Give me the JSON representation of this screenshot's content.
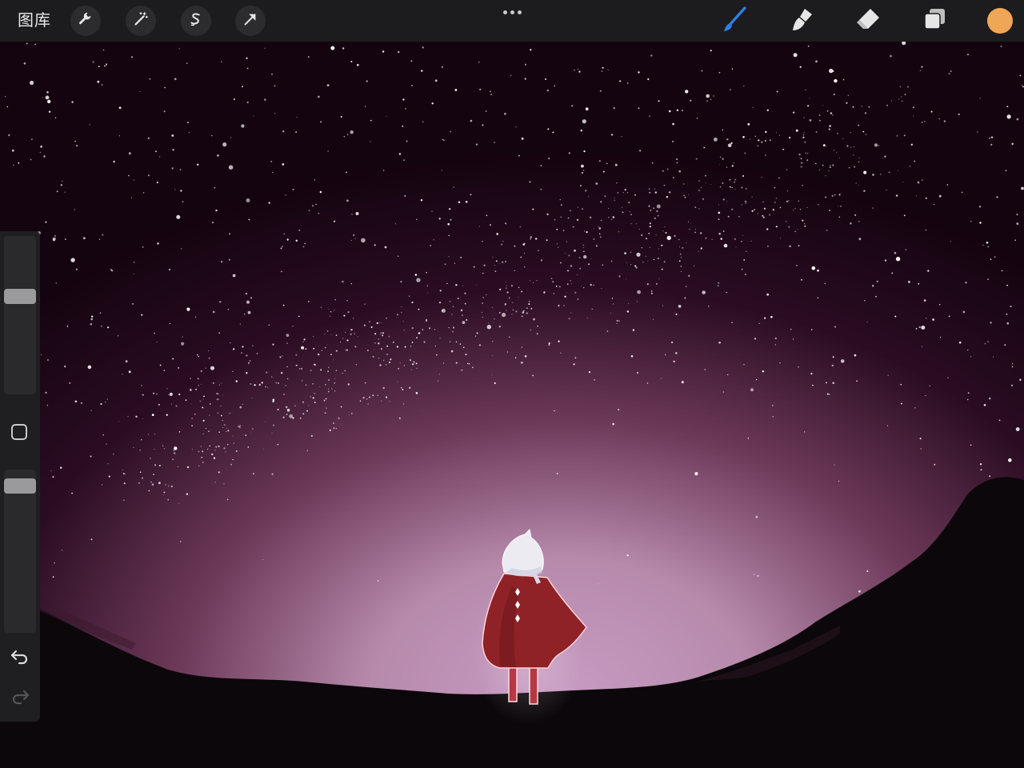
{
  "app": {
    "gallery_label": "图库"
  },
  "toolbar_left": {
    "items": [
      {
        "icon": "wrench-icon"
      },
      {
        "icon": "magic-wand-icon"
      },
      {
        "icon": "selection-s-icon"
      },
      {
        "icon": "transform-arrow-icon"
      }
    ]
  },
  "toolbar_right": {
    "items": [
      {
        "icon": "brush-icon",
        "active": true
      },
      {
        "icon": "smudge-icon"
      },
      {
        "icon": "eraser-icon"
      },
      {
        "icon": "layers-icon"
      }
    ],
    "current_color": "#f0a657",
    "brush_accent": "#2f7fe8"
  },
  "sidebar": {
    "brush_size_level": 0.63,
    "opacity_level": 0.94
  },
  "canvas": {
    "sky_top": "#14040f",
    "glow_color": "#c79bc3",
    "cape_color": "#8e2227",
    "ground_color": "#0c070a"
  }
}
